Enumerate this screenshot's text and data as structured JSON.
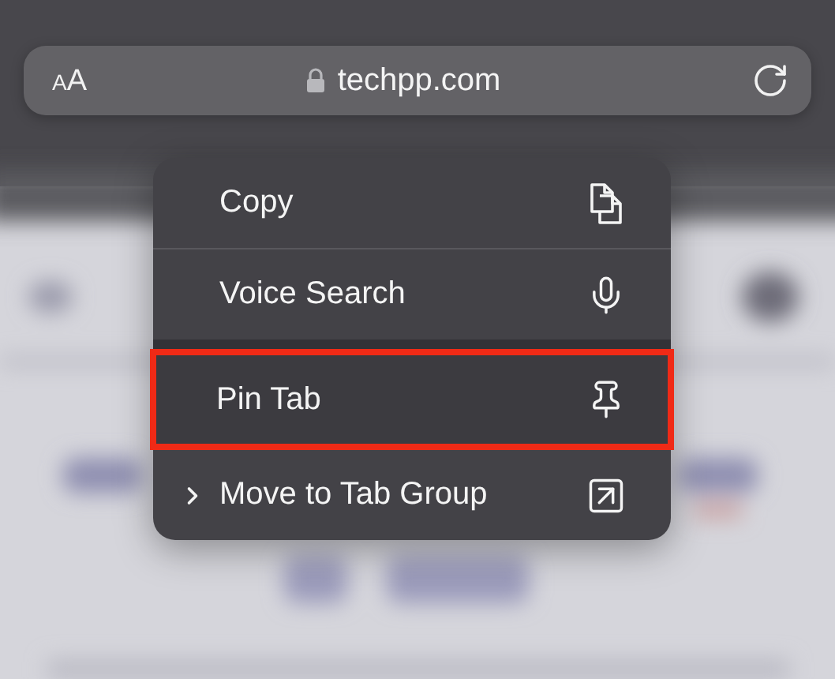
{
  "address_bar": {
    "text_size_button": "AA",
    "url": "techpp.com",
    "secure": true
  },
  "context_menu": {
    "items": [
      {
        "label": "Copy",
        "kind": "copy",
        "has_submenu": false,
        "group_start": false,
        "highlighted": false
      },
      {
        "label": "Voice Search",
        "kind": "mic",
        "has_submenu": false,
        "group_start": false,
        "highlighted": false
      },
      {
        "label": "Pin Tab",
        "kind": "pin",
        "has_submenu": false,
        "group_start": true,
        "highlighted": true
      },
      {
        "label": "Move to Tab Group",
        "kind": "move",
        "has_submenu": true,
        "group_start": false,
        "highlighted": false
      }
    ]
  }
}
